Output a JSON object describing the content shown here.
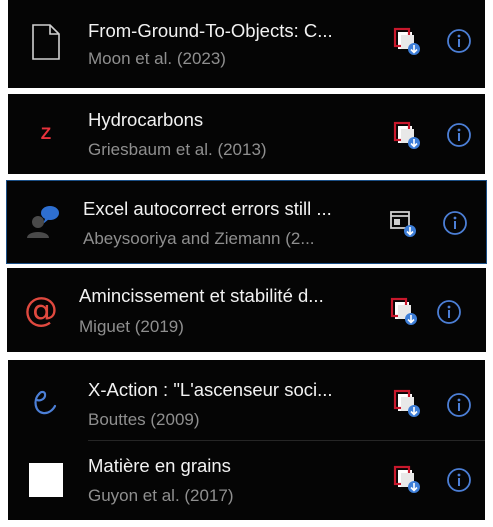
{
  "items": [
    {
      "title": "From-Ground-To-Objects: C...",
      "subtitle": "Moon et al. (2023)",
      "icon": "document-icon"
    },
    {
      "title": "Hydrocarbons",
      "subtitle": "Griesbaum et al. (2013)",
      "icon": "z-logo-icon",
      "icon_text": "Z"
    },
    {
      "title": "Excel autocorrect errors still ...",
      "subtitle": "Abeysooriya and Ziemann (2...",
      "icon": "user-chat-icon"
    },
    {
      "title": "Amincissement et stabilité d...",
      "subtitle": "Miguet (2019)",
      "icon": "at-sign-icon",
      "icon_text": "@"
    },
    {
      "title": "X-Action : \"L'ascenseur soci...",
      "subtitle": "Bouttes (2009)",
      "icon": "script-e-icon"
    },
    {
      "title": "Matière en grains",
      "subtitle": "Guyon et al. (2017)",
      "icon": "white-square-icon"
    }
  ],
  "colors": {
    "accent_blue": "#4c7fd6",
    "pdf_red": "#c8182c",
    "background": "#050505",
    "selected_border": "#1b4f86"
  }
}
